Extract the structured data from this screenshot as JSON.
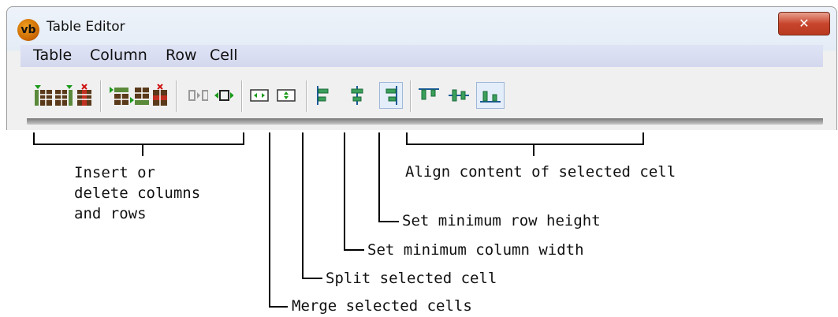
{
  "window": {
    "title": "Table Editor",
    "icon_text": "vb",
    "close_glyph": "✕"
  },
  "menu": [
    "Table",
    "Column",
    "Row",
    "Cell"
  ],
  "toolbar": {
    "groups": [
      {
        "name": "insert-delete",
        "buttons": [
          "insert-column-left-icon",
          "insert-column-right-icon",
          "delete-column-icon",
          "insert-row-above-icon",
          "insert-row-below-icon",
          "delete-row-icon"
        ]
      },
      {
        "name": "merge-split",
        "buttons": [
          "merge-cells-icon",
          "split-cell-icon"
        ]
      },
      {
        "name": "min-size",
        "buttons": [
          "min-column-width-icon",
          "min-row-height-icon"
        ]
      },
      {
        "name": "align",
        "buttons": [
          "align-left-icon",
          "align-center-icon",
          "align-right-icon",
          "align-top-icon",
          "align-middle-icon",
          "align-bottom-icon"
        ],
        "pressed": [
          "align-right-icon",
          "align-bottom-icon"
        ]
      }
    ]
  },
  "callouts": {
    "insert_delete": [
      "Insert or",
      "delete columns",
      "and rows"
    ],
    "align": "Align content of selected cell",
    "min_row_height": "Set minimum row height",
    "min_column_width": "Set minimum column width",
    "split": "Split selected cell",
    "merge": "Merge selected cells"
  },
  "colors": {
    "table_icon": "#5a3a1a",
    "insert_arrow": "#1a9a1a",
    "delete_x": "#d01010",
    "align_icon": "#2a7a9a",
    "menubar": "#d8dcf0"
  }
}
